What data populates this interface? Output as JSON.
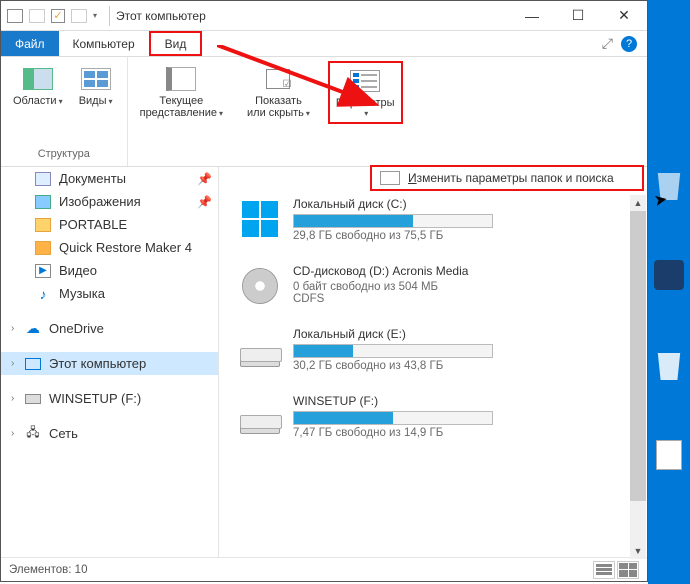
{
  "title": "Этот компьютер",
  "menu": {
    "file": "Файл",
    "computer": "Компьютер",
    "view": "Вид"
  },
  "ribbon": {
    "panes": "Области",
    "views": "Виды",
    "structure_label": "Структура",
    "current_view": "Текущее\nпредставление",
    "show_hide": "Показать\nили скрыть",
    "options": "Параметры"
  },
  "dropdown": {
    "change_options_pre": "И",
    "change_options": "зменить параметры папок и поиска"
  },
  "sidebar": {
    "items": [
      {
        "label": "Документы"
      },
      {
        "label": "Изображения"
      },
      {
        "label": "PORTABLE"
      },
      {
        "label": "Quick Restore Maker 4"
      },
      {
        "label": "Видео"
      },
      {
        "label": "Музыка"
      },
      {
        "label": "OneDrive"
      },
      {
        "label": "Этот компьютер"
      },
      {
        "label": "WINSETUP (F:)"
      },
      {
        "label": "Сеть"
      }
    ]
  },
  "drives": [
    {
      "name": "Локальный диск (C:)",
      "stats": "29,8 ГБ свободно из 75,5 ГБ",
      "pct": 60,
      "type": "win"
    },
    {
      "name": "CD-дисковод (D:) Acronis Media",
      "stats": "0 байт свободно из 504 МБ",
      "fs": "CDFS",
      "pct": 0,
      "type": "cd"
    },
    {
      "name": "Локальный диск (E:)",
      "stats": "30,2 ГБ свободно из 43,8 ГБ",
      "pct": 30,
      "type": "disk"
    },
    {
      "name": "WINSETUP (F:)",
      "stats": "7,47 ГБ свободно из 14,9 ГБ",
      "pct": 50,
      "type": "disk"
    }
  ],
  "status": "Элементов: 10"
}
